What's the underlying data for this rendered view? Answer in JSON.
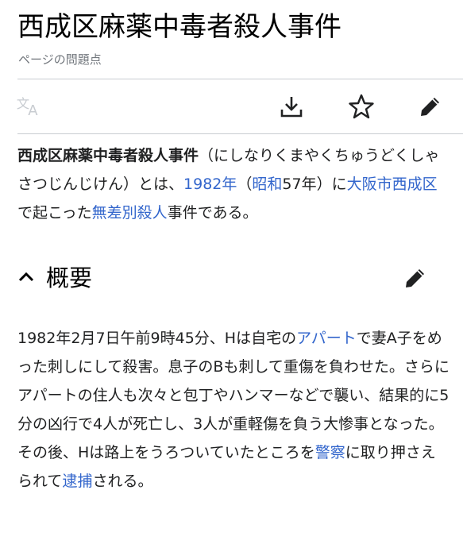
{
  "article": {
    "title": "西成区麻薬中毒者殺人事件",
    "page_issues": "ページの問題点"
  },
  "toolbar": {
    "language_icon": "translate-icon",
    "download_icon": "download-icon",
    "watch_icon": "star-icon",
    "edit_icon": "pencil-icon"
  },
  "lead": {
    "bold_term": "西成区麻薬中毒者殺人事件",
    "t1": "（にしなりくまやくちゅうどくしゃさつじんじけん）とは、",
    "link_year": "1982年",
    "t2": "（",
    "link_era": "昭和",
    "t3": "57年）に",
    "link_place": "大阪市西成区",
    "t4": "で起こった",
    "link_type": "無差別殺人",
    "t5": "事件である。"
  },
  "section": {
    "title": "概要",
    "toggle_icon": "chevron-up-icon",
    "edit_icon": "pencil-icon"
  },
  "overview": {
    "t1": "1982年2月7日午前9時45分、Hは自宅の",
    "link_apartment": "アパート",
    "t2": "で妻A子をめった刺しにして殺害。息子のBも刺して重傷を負わせた。さらにアパートの住人も次々と包丁やハンマーなどで襲い、結果的に5分の凶行で4人が死亡し、3人が重軽傷を負う大惨事となった。その後、Hは路上をうろついていたところを",
    "link_police": "警察",
    "t3": "に取り押さえられて",
    "link_arrest": "逮捕",
    "t4": "される。"
  },
  "colors": {
    "link": "#3366cc",
    "text": "#202122",
    "muted": "#72777d",
    "divider": "#c8ccd1"
  }
}
